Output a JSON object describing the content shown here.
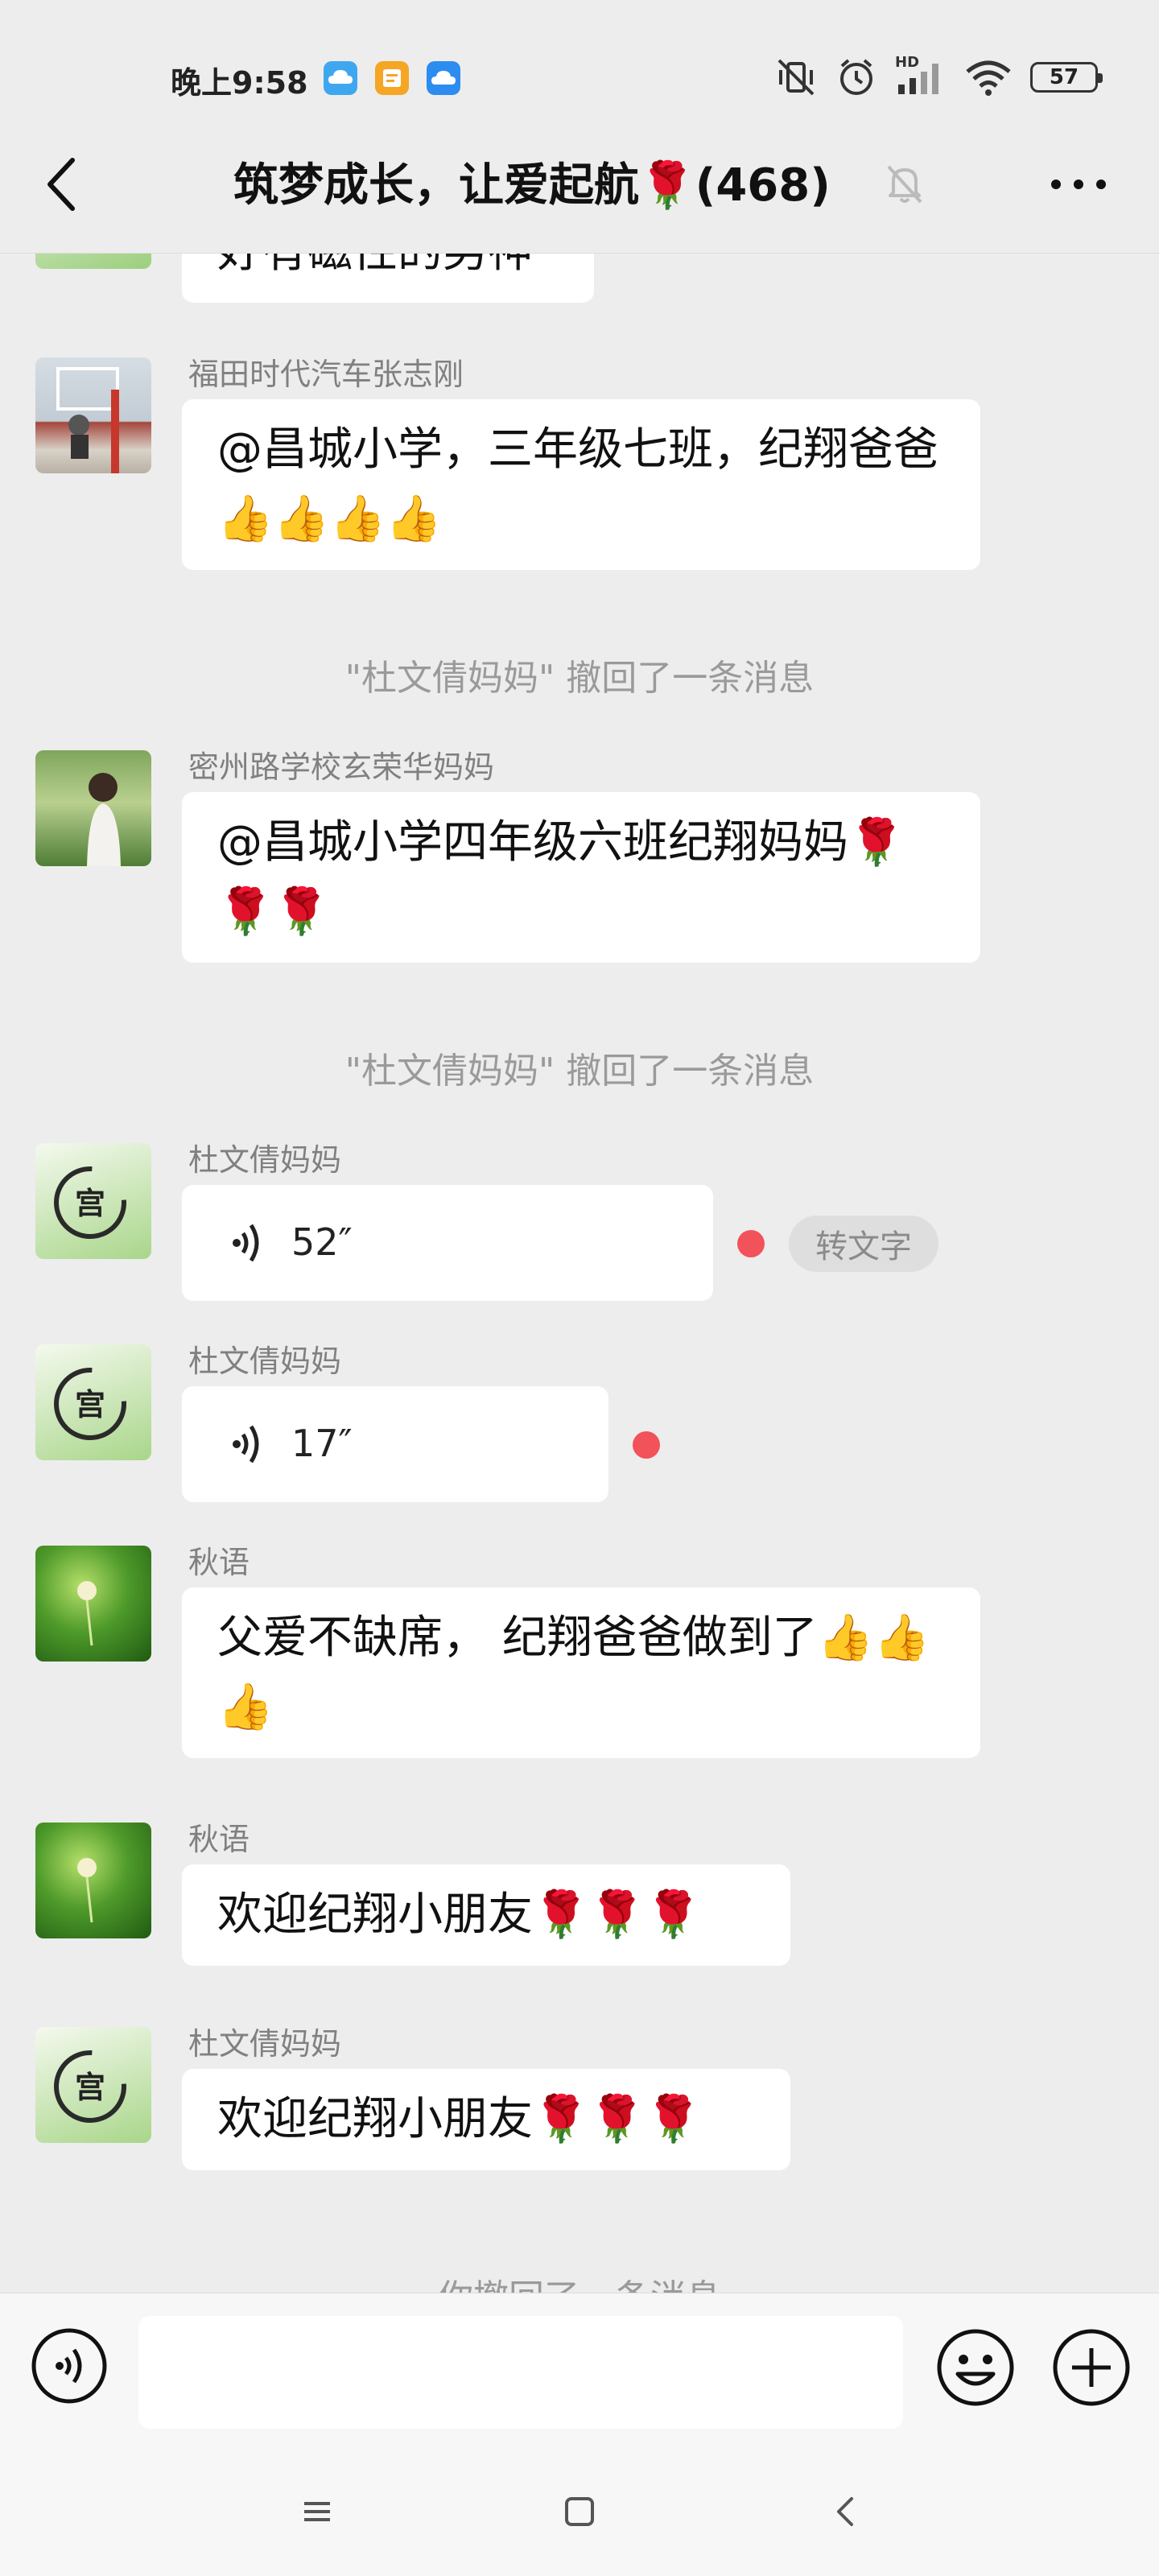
{
  "status_bar": {
    "time": "晚上9:58",
    "battery": "57",
    "network_label": "HD"
  },
  "nav": {
    "title": "筑梦成长，让爱起航🌹(468)"
  },
  "messages": [
    {
      "type": "text",
      "text": "好有磁性的男神"
    },
    {
      "type": "text",
      "sender": "福田时代汽车张志刚",
      "text": "@昌城小学，三年级七班，纪翔爸爸 👍👍👍👍"
    },
    {
      "type": "system",
      "text": "\"杜文倩妈妈\" 撤回了一条消息"
    },
    {
      "type": "text",
      "sender": "密州路学校玄荣华妈妈",
      "text": "@昌城小学四年级六班纪翔妈妈🌹🌹🌹"
    },
    {
      "type": "system",
      "text": "\"杜文倩妈妈\" 撤回了一条消息"
    },
    {
      "type": "voice",
      "sender": "杜文倩妈妈",
      "duration": "52″",
      "action": "转文字"
    },
    {
      "type": "voice",
      "sender": "杜文倩妈妈",
      "duration": "17″"
    },
    {
      "type": "text",
      "sender": "秋语",
      "text": "父爱不缺席， 纪翔爸爸做到了👍👍👍"
    },
    {
      "type": "text",
      "sender": "秋语",
      "text": "欢迎纪翔小朋友🌹🌹🌹"
    },
    {
      "type": "text",
      "sender": "杜文倩妈妈",
      "text": "欢迎纪翔小朋友🌹🌹🌹"
    },
    {
      "type": "system",
      "text": "你撤回了一条消息"
    }
  ],
  "avatars": {
    "palace_char": "宫"
  },
  "icons": {
    "back": "chevron-left-icon",
    "mute": "bell-off-icon",
    "more": "more-dots-icon",
    "voice_input": "voice-icon",
    "emoji": "smiley-icon",
    "plus": "plus-icon"
  },
  "colors": {
    "background": "#ededed",
    "bubble": "#ffffff",
    "unread_dot": "#f2525a",
    "system_text": "#9a9a9a"
  }
}
